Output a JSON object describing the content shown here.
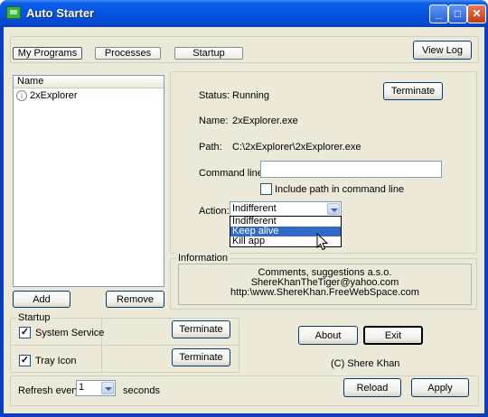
{
  "window": {
    "title": "Auto Starter",
    "minimize": "_",
    "maximize": "□",
    "close": "✕"
  },
  "tabs": [
    {
      "label": "My Programs"
    },
    {
      "label": "Processes"
    },
    {
      "label": "Startup"
    }
  ],
  "view_log_label": "View Log",
  "list": {
    "header": "Name",
    "items": [
      {
        "name": "2xExplorer",
        "icon": "info-icon"
      }
    ]
  },
  "details": {
    "status_label": "Status:",
    "status_value": "Running",
    "terminate_label": "Terminate",
    "name_label": "Name:",
    "name_value": "2xExplorer.exe",
    "path_label": "Path:",
    "path_value": "C:\\2xExplorer\\2xExplorer.exe",
    "command_line_label": "Command line:",
    "command_line_value": "",
    "include_path_label": "Include path in command line",
    "include_path_checked": false,
    "action_label": "Action:",
    "action_value": "Indifferent",
    "action_options": [
      "Indifferent",
      "Keep alive",
      "Kill app"
    ],
    "action_highlighted": "Keep alive"
  },
  "information": {
    "legend": "Information",
    "lines": [
      "Comments, suggestions a.s.o.",
      "ShereKhanTheTiger@yahoo.com",
      "http:\\www.ShereKhan.FreeWebSpace.com"
    ]
  },
  "add_label": "Add",
  "remove_label": "Remove",
  "startup": {
    "legend": "Startup",
    "system_service_label": "System Service",
    "system_service_checked": true,
    "tray_icon_label": "Tray Icon",
    "tray_icon_checked": true,
    "terminate_label": "Terminate"
  },
  "about_label": "About",
  "exit_label": "Exit",
  "copyright": "(C) Shere Khan",
  "refresh": {
    "label": "Refresh every",
    "value": "1",
    "unit": "seconds"
  },
  "reload_label": "Reload",
  "apply_label": "Apply",
  "check_mark": "✓"
}
